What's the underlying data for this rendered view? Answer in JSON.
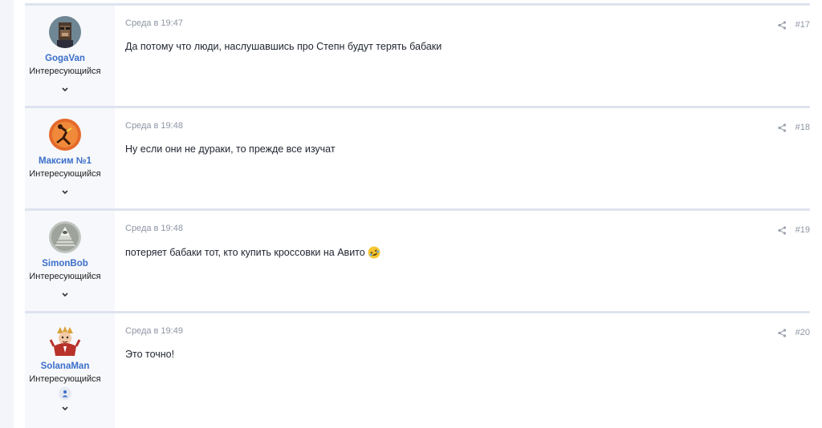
{
  "posts": [
    {
      "username": "GogaVan",
      "user_title": "Интересующийся",
      "date": "Среда в 19:47",
      "text": "Да потому что люди, наслушавшись про Степн будут терять бабаки",
      "number": "#17",
      "avatar": "pixel-ape-avatar"
    },
    {
      "username": "Максим №1",
      "user_title": "Интересующийся",
      "date": "Среда в 19:48",
      "text": "Ну если они не дураки, то прежде все изучат",
      "number": "#18",
      "avatar": "orange-figure-avatar"
    },
    {
      "username": "SimonBob",
      "user_title": "Интересующийся",
      "date": "Среда в 19:48",
      "text": "потеряет бабаки тот, кто купить кроссовки на Авито",
      "number": "#19",
      "avatar": "pyramid-eye-avatar",
      "emoji": "rolling-laughing-emoji"
    },
    {
      "username": "SolanaMan",
      "user_title": "Интересующийся",
      "date": "Среда в 19:49",
      "text": "Это точно!",
      "number": "#20",
      "avatar": "cartoon-character-avatar",
      "badge": "user-badge-icon"
    }
  ],
  "colors": {
    "username": "#3b6fc9",
    "meta": "#8e95a4",
    "separator": "#dee3ef",
    "user_panel": "#f7f8fb"
  }
}
